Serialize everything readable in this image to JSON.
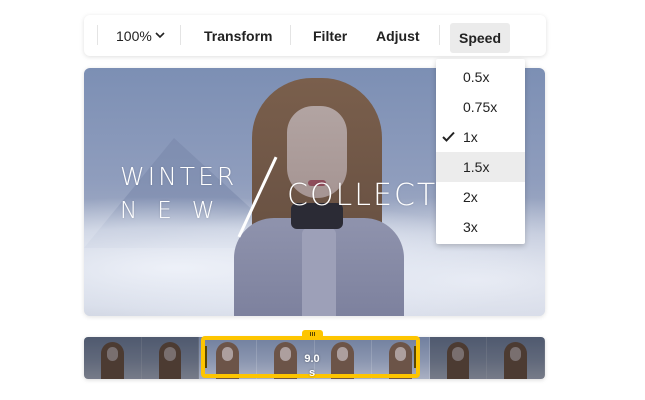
{
  "toolbar": {
    "zoom_label": "100%",
    "transform_label": "Transform",
    "filter_label": "Filter",
    "adjust_label": "Adjust",
    "speed_label": "Speed"
  },
  "icons": {
    "zoom_dropdown": "chevron-down-icon",
    "selected_speed": "check-icon"
  },
  "preview": {
    "overlay_line1": "WINTER",
    "overlay_line2": "NEW",
    "overlay_line3": "COLLECT"
  },
  "speed_menu": {
    "options": [
      "0.5x",
      "0.75x",
      "1x",
      "1.5x",
      "2x",
      "3x"
    ],
    "selected": "1x",
    "hovered": "1.5x"
  },
  "timeline": {
    "duration_value": "9.0",
    "duration_unit": "s"
  },
  "colors": {
    "selection": "#fdc500",
    "menu_hover": "#ececec",
    "speed_button_bg": "#ebebeb"
  }
}
